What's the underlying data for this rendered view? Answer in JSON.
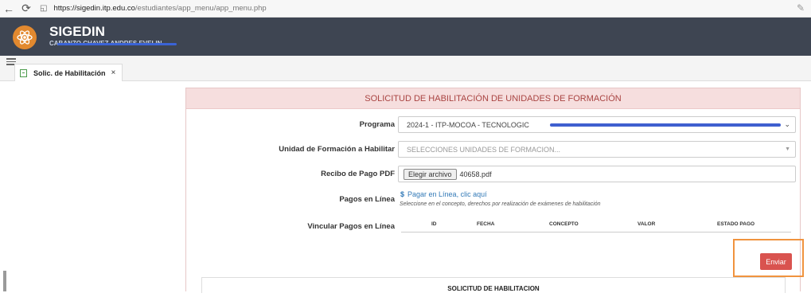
{
  "browser": {
    "back_icon": "arrow-left-icon",
    "reload_icon": "reload-icon",
    "url_host": "https://sigedin.itp.edu.co",
    "url_path": "/estudiantes/app_menu/app_menu.php"
  },
  "app": {
    "title": "SIGEDIN",
    "user": "CABANZO CHAVEZ ANDRES EVELIN"
  },
  "tabs": [
    {
      "label": "Solic. de Habilitación",
      "close": "×"
    }
  ],
  "form": {
    "header": "SOLICITUD DE HABILITACIÓN DE UNIDADES DE FORMACIÓN",
    "programa_label": "Programa",
    "programa_value": "2024-1 - ITP-MOCOA - TECNOLOGIC",
    "unidad_label": "Unidad de Formación a Habilitar",
    "unidad_placeholder": "SELECCIONES UNIDADES DE FORMACION...",
    "recibo_label": "Recibo de Pago PDF",
    "file_button": "Elegir archivo",
    "file_name": "40658.pdf",
    "pagos_label": "Pagos en Línea",
    "pagos_link": "Pagar en Línea, clic aquí",
    "pagos_note": "Seleccione en el concepto, derechos por realización de exámenes de habilitación",
    "vincular_label": "Vincular Pagos en Línea",
    "table_headers": [
      "ID",
      "FECHA",
      "CONCEPTO",
      "VALOR",
      "ESTADO PAGO"
    ],
    "send_button": "Enviar",
    "sub_header": "SOLICITUD DE HABILITACION"
  },
  "colors": {
    "header_bg": "#3e4552",
    "panel_head_bg": "#f6dede",
    "panel_head_text": "#a94442",
    "send_button": "#d9534f",
    "highlight": "#f0933e",
    "link": "#337ab7"
  }
}
